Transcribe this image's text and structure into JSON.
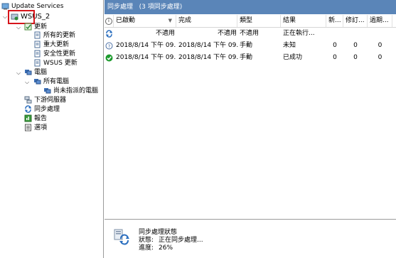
{
  "tree": {
    "root": "Update Services",
    "server": "WSUS_2",
    "updates": "更新",
    "all_updates": "所有的更新",
    "critical_updates": "重大更新",
    "security_updates": "安全性更新",
    "wsus_updates": "WSUS 更新",
    "computers": "電腦",
    "all_computers": "所有電腦",
    "unassigned_computers": "尚未指派的電腦",
    "downstream_servers": "下游伺服器",
    "synchronizations": "同步處理",
    "reports": "報告",
    "options": "選項"
  },
  "panel": {
    "title": "同步處理",
    "count_label": "(3 項同步處理)"
  },
  "columns": [
    "已啟動",
    "完成",
    "類型",
    "結果",
    "新...",
    "修訂...",
    "過期..."
  ],
  "rows": [
    {
      "started": "不適用",
      "finished": "不適用",
      "type": "不適用",
      "result": "正在執行...",
      "new": "",
      "revised": "",
      "expired": "",
      "icon": "sync-running-icon"
    },
    {
      "started": "2018/8/14 下午 09...",
      "finished": "2018/8/14 下午 09...",
      "type": "手動",
      "result": "未知",
      "new": "0",
      "revised": "0",
      "expired": "0",
      "icon": "question-icon"
    },
    {
      "started": "2018/8/14 下午 09...",
      "finished": "2018/8/14 下午 09...",
      "type": "手動",
      "result": "已成功",
      "new": "0",
      "revised": "0",
      "expired": "0",
      "icon": "success-check-icon"
    }
  ],
  "status": {
    "heading": "同步處理狀態",
    "state_label": "狀態:",
    "state_value": "正在同步處理...",
    "progress_label": "進度:",
    "progress_value": "26%"
  },
  "colors": {
    "title_bar": "#5a85b8",
    "highlight": "#d6151b",
    "success": "#1e9b2e"
  }
}
